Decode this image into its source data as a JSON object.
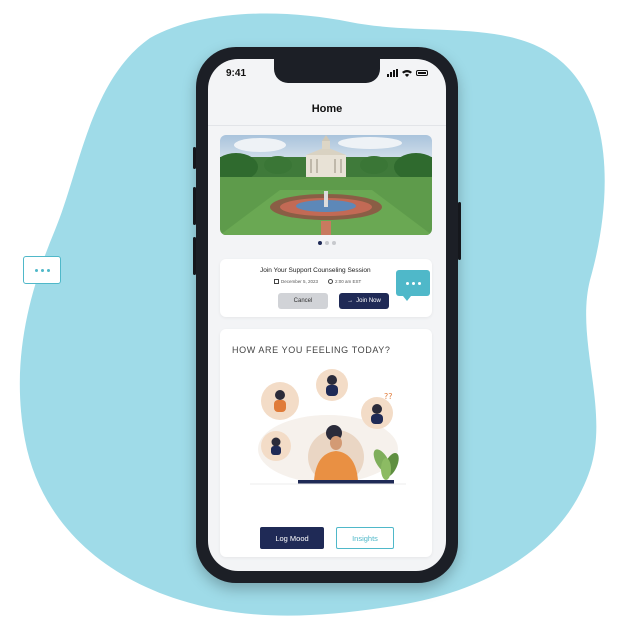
{
  "status_bar": {
    "time": "9:41"
  },
  "nav": {
    "title": "Home"
  },
  "carousel": {
    "page_count": 3,
    "active_index": 0
  },
  "session": {
    "title": "Join Your Support Counseling Session",
    "date": "December 5, 2023",
    "time": "2:00 am EST",
    "cancel_label": "Cancel",
    "join_label": "Join Now"
  },
  "mood": {
    "question": "HOW ARE YOU FEELING TODAY?",
    "log_label": "Log Mood",
    "insights_label": "Insights"
  },
  "colors": {
    "blob": "#9fdbe8",
    "navy": "#1f2a56",
    "teal": "#4fb8c9",
    "phone": "#1c1f26"
  }
}
